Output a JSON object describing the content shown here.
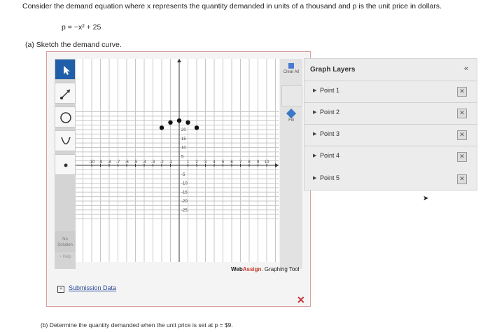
{
  "question": {
    "prompt": "Consider the demand equation where x represents the quantity demanded in units of a thousand and p is the unit price in dollars.",
    "equation": "p = −x² + 25",
    "part_a": "(a)   Sketch the demand curve.",
    "part_b": "(b)   Determine the quantity demanded when the unit price is set at p = $9."
  },
  "tool": {
    "clear_all": "Clear All",
    "fill": "Fill",
    "no_solution": "No Solution",
    "help": "Help",
    "brand_web": "Web",
    "brand_assign": "Assign",
    "brand_suffix": ". Graphing Tool",
    "submission_data": "Submission Data",
    "x_ticks": [
      "-10",
      "-9",
      "-8",
      "-7",
      "-6",
      "-5",
      "-4",
      "-3",
      "-2",
      "-1",
      "1",
      "2",
      "3",
      "4",
      "5",
      "6",
      "7",
      "8",
      "9",
      "10"
    ],
    "y_ticks": [
      "20",
      "15",
      "10",
      "5",
      "-5",
      "-10",
      "-15",
      "-20",
      "-25"
    ]
  },
  "layers": {
    "title": "Graph Layers",
    "collapse": "«",
    "items": [
      "Point 1",
      "Point 2",
      "Point 3",
      "Point 4",
      "Point 5"
    ],
    "delete_symbol": "✕"
  },
  "icons": {
    "pointer": "arrow-pointer-icon",
    "segment": "line-segment-icon",
    "circle": "circle-icon",
    "parabola": "parabola-icon",
    "point": "point-icon"
  }
}
